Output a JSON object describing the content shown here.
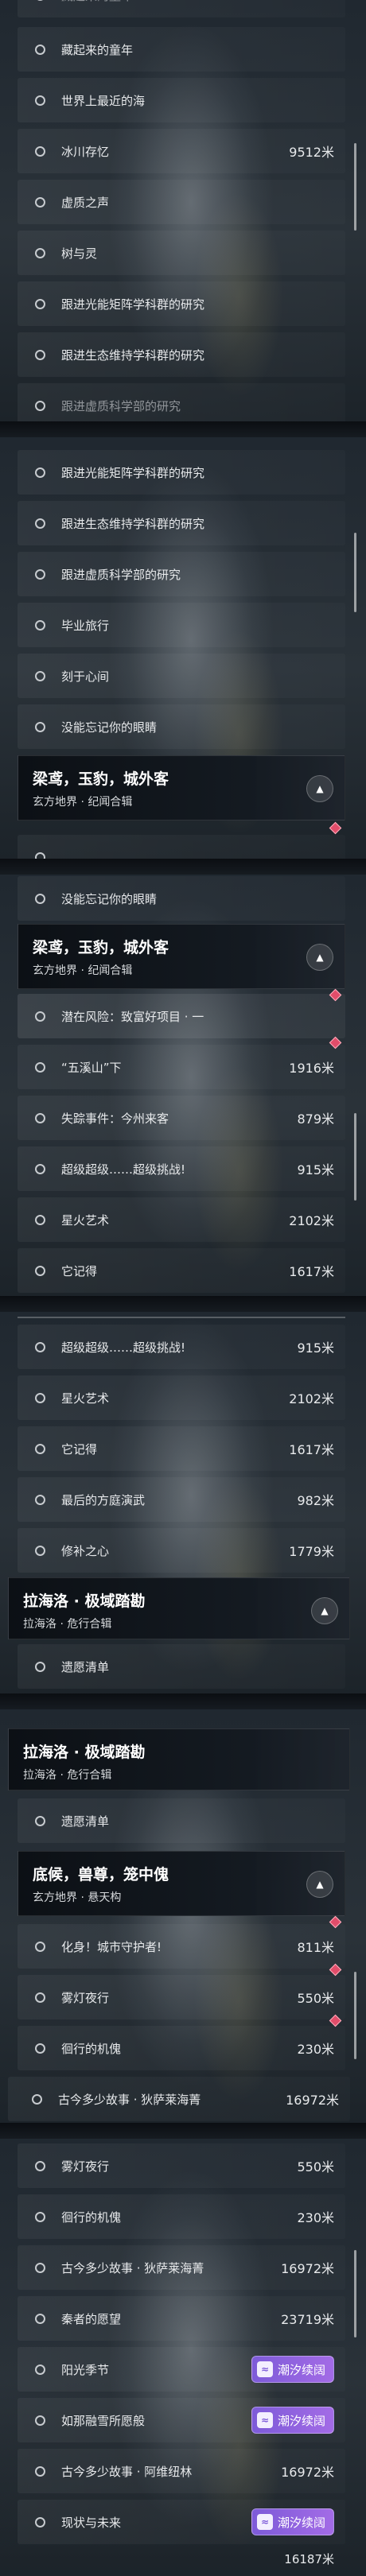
{
  "screens": [
    {
      "rows": [
        {
          "label": "藏起来的童年",
          "distance": ""
        },
        {
          "label": "世界上最近的海",
          "distance": ""
        },
        {
          "label": "冰川存忆",
          "distance": "9512米"
        },
        {
          "label": "虚质之声",
          "distance": ""
        },
        {
          "label": "树与灵",
          "distance": ""
        },
        {
          "label": "跟进光能矩阵学科群的研究",
          "distance": ""
        },
        {
          "label": "跟进生态维持学科群的研究",
          "distance": ""
        },
        {
          "label": "跟进虚质科学部的研究",
          "distance": ""
        }
      ]
    },
    {
      "rows": [
        {
          "label": "跟进光能矩阵学科群的研究",
          "distance": ""
        },
        {
          "label": "跟进生态维持学科群的研究",
          "distance": ""
        },
        {
          "label": "跟进虚质科学部的研究",
          "distance": ""
        },
        {
          "label": "毕业旅行",
          "distance": ""
        },
        {
          "label": "刻于心间",
          "distance": ""
        },
        {
          "label": "没能忘记你的眼睛",
          "distance": ""
        }
      ],
      "header": {
        "title": "梁鸢，玉豹，城外客",
        "subtitle": "玄方地界 · 纪闻合辑"
      }
    },
    {
      "top_row": {
        "label": "没能忘记你的眼睛",
        "distance": ""
      },
      "header": {
        "title": "梁鸢，玉豹，城外客",
        "subtitle": "玄方地界 · 纪闻合辑"
      },
      "rows": [
        {
          "label": "潜在风险：致富好项目 · 一",
          "distance": ""
        },
        {
          "label": "“五溪山”下",
          "distance": "1916米"
        },
        {
          "label": "失踪事件：今州来客",
          "distance": "879米"
        },
        {
          "label": "超级超级……超级挑战!",
          "distance": "915米"
        },
        {
          "label": "星火艺术",
          "distance": "2102米"
        },
        {
          "label": "它记得",
          "distance": "1617米"
        }
      ]
    },
    {
      "rows": [
        {
          "label": "超级超级……超级挑战!",
          "distance": "915米"
        },
        {
          "label": "星火艺术",
          "distance": "2102米"
        },
        {
          "label": "它记得",
          "distance": "1617米"
        },
        {
          "label": "最后的方庭演武",
          "distance": "982米"
        },
        {
          "label": "修补之心",
          "distance": "1779米"
        }
      ],
      "header": {
        "title": "拉海洛 · 极域踏勘",
        "subtitle": "拉海洛 · 危行合辑"
      },
      "bottom_row": {
        "label": "遗愿清单",
        "distance": ""
      }
    },
    {
      "header": {
        "title": "拉海洛 · 极域踏勘",
        "subtitle": "拉海洛 · 危行合辑"
      },
      "top_row": {
        "label": "遗愿清单",
        "distance": ""
      },
      "header2": {
        "title": "底候，兽尊，笼中傀",
        "subtitle": "玄方地界 · 悬天构"
      },
      "rows": [
        {
          "label": "化身！城市守护者!",
          "distance": "811米"
        },
        {
          "label": "雾灯夜行",
          "distance": "550米"
        },
        {
          "label": "徊行的机傀",
          "distance": "230米"
        }
      ],
      "bottom_row": {
        "label": "古今多少故事 · 狄萨莱海菁",
        "distance": "16972米"
      }
    },
    {
      "rows": [
        {
          "label": "雾灯夜行",
          "distance": "550米"
        },
        {
          "label": "徊行的机傀",
          "distance": "230米"
        },
        {
          "label": "古今多少故事 · 狄萨莱海菁",
          "distance": "16972米"
        },
        {
          "label": "秦者的愿望",
          "distance": "23719米"
        },
        {
          "label": "阳光季节",
          "distance": "",
          "badge": "潮汐续阔"
        },
        {
          "label": "如那融雪所愿般",
          "distance": "",
          "badge": "潮汐续阔"
        },
        {
          "label": "古今多少故事 · 阿维纽林",
          "distance": "16972米"
        },
        {
          "label": "现状与未来",
          "distance": "16187米",
          "badge": "潮汐续阔"
        }
      ]
    }
  ],
  "colors": {
    "marker": "#e14d6a",
    "badge": "#8b5fe0",
    "background": "#15191f"
  },
  "icons": {
    "row": "circle-outline-icon",
    "collapse": "chevron-up-icon",
    "marker": "diamond-marker-icon",
    "badge": "tide-icon"
  }
}
